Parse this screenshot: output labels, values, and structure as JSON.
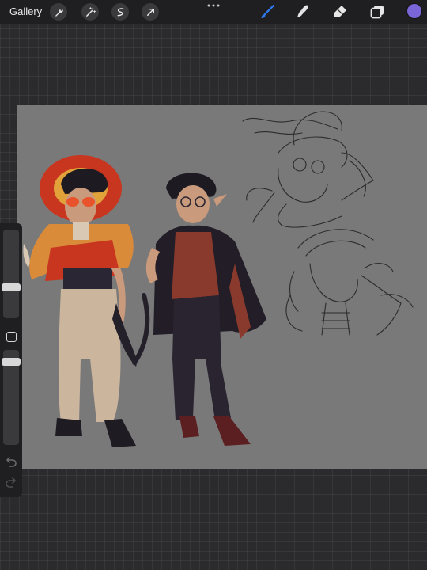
{
  "topbar": {
    "gallery_label": "Gallery",
    "left_tools": [
      "wrench-icon",
      "magic-wand-icon",
      "selection-icon",
      "transform-arrow-icon"
    ],
    "more_icon": "more-dots-icon",
    "right_tools": [
      "brush-icon",
      "smudge-icon",
      "eraser-icon",
      "layers-icon"
    ],
    "active_tool": "brush-icon",
    "active_tool_color": "#2f7bf5",
    "current_color": "#7a66d6"
  },
  "sidebar": {
    "brush_size_slider": "brush-size-slider",
    "opacity_slider": "opacity-slider",
    "modify_button": "modify-button",
    "undo_icon": "undo-icon",
    "redo_icon": "redo-icon"
  },
  "canvas": {
    "background_color": "#797979",
    "artwork": "character-illustration-sketches"
  }
}
